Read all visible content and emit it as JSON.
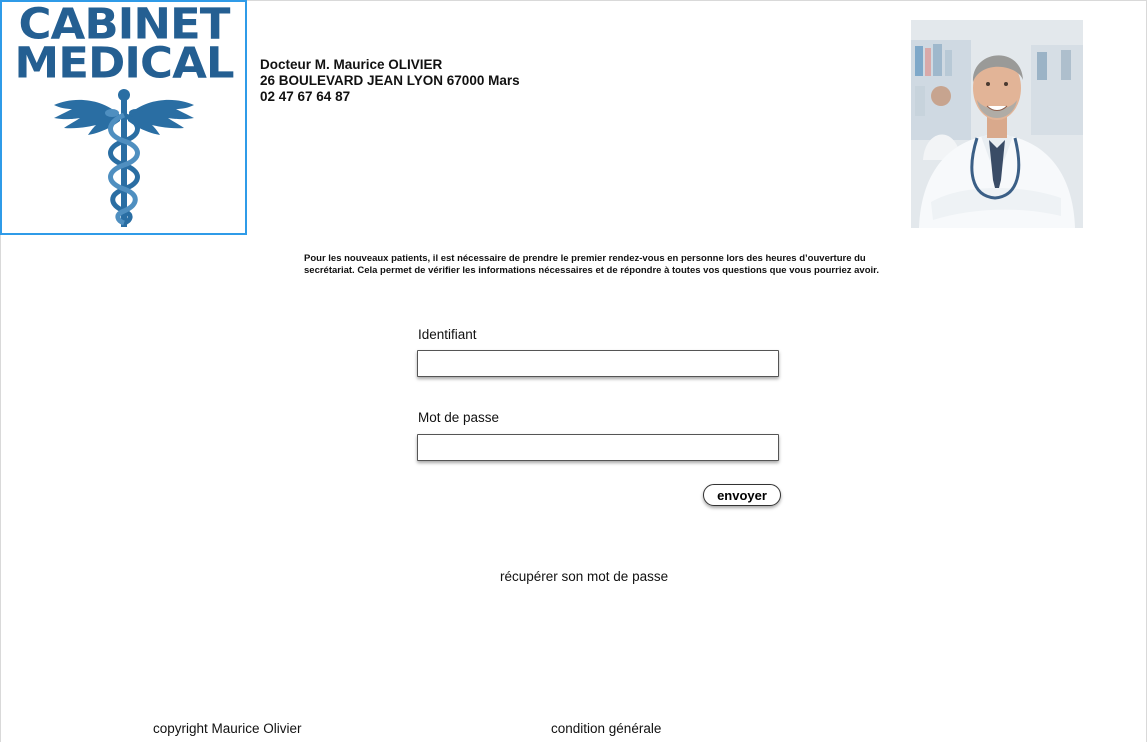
{
  "logo": {
    "line1": "CABINET",
    "line2": "MEDICAL",
    "icon": "caduceus-icon",
    "color": "#245f92",
    "border_color": "#2f9be8"
  },
  "doctor": {
    "name": "Docteur M. Maurice  OLIVIER",
    "address": "26 BOULEVARD JEAN LYON 67000 Mars",
    "phone": "02 47 67 64 87"
  },
  "photo": {
    "subject": "smiling-doctor-photo"
  },
  "notice": "Pour les nouveaux patients, il est nécessaire de prendre le premier rendez-vous en personne lors des heures d’ouverture du secrétariat. Cela permet de vérifier les informations nécessaires et de répondre à toutes vos  questions que vous pourriez avoir.",
  "login": {
    "username_label": "Identifiant",
    "username_value": "",
    "password_label": "Mot de passe",
    "password_value": "",
    "submit_label": "envoyer"
  },
  "recover_link": "récupérer son mot de passe",
  "footer": {
    "copyright": "copyright Maurice Olivier",
    "terms": "condition générale"
  }
}
